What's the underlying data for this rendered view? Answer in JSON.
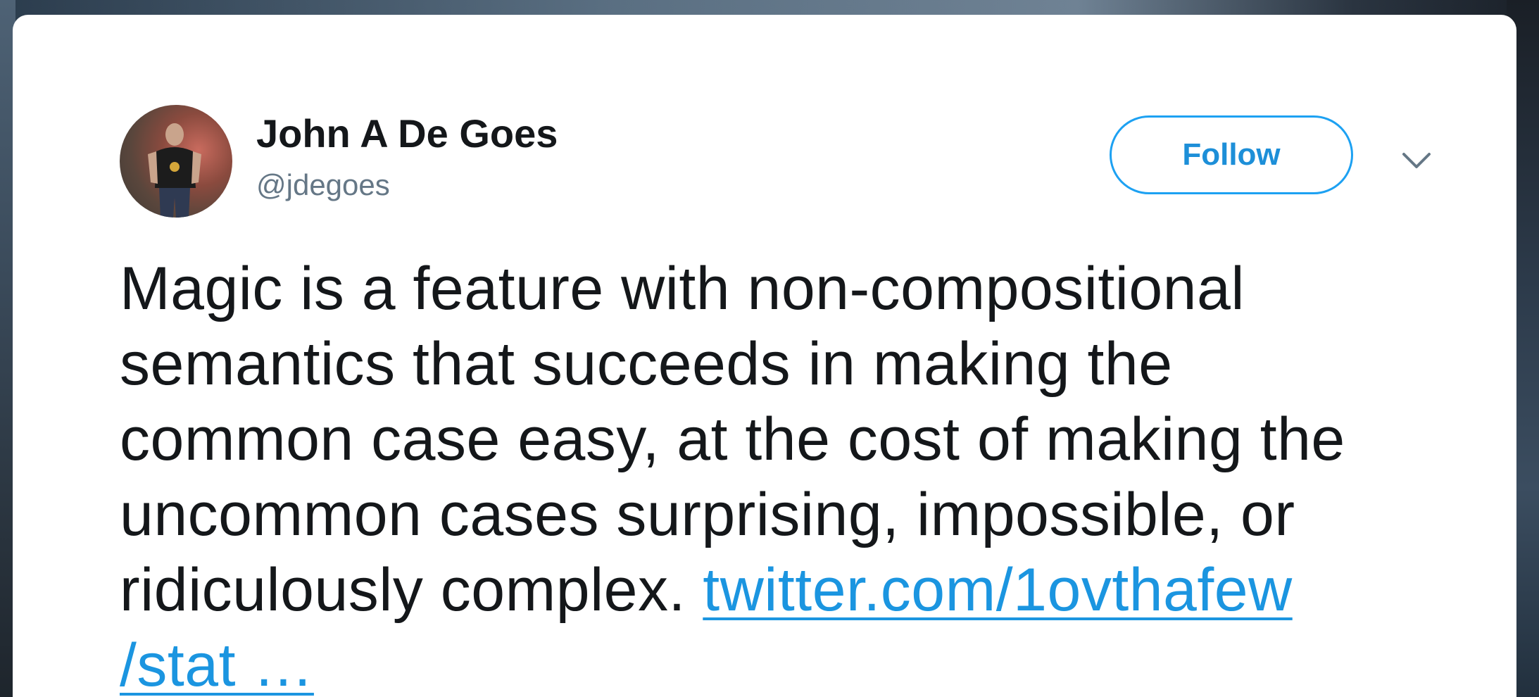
{
  "author": {
    "name": "John A De Goes",
    "handle": "@jdegoes"
  },
  "actions": {
    "follow_label": "Follow",
    "menu_icon": "chevron-down-icon"
  },
  "tweet": {
    "lines": [
      "Magic is a feature with non-compositional",
      "semantics that succeeds in making the",
      "common case easy, at the cost of making the",
      "uncommon cases surprising, impossible, or",
      "ridiculously complex. "
    ],
    "link_part1": "twitter.com/1ovthafew",
    "link_part2": "/stat …"
  },
  "colors": {
    "accent": "#1da1f2",
    "link": "#1b95e0",
    "text": "#14171a",
    "muted": "#657786"
  }
}
